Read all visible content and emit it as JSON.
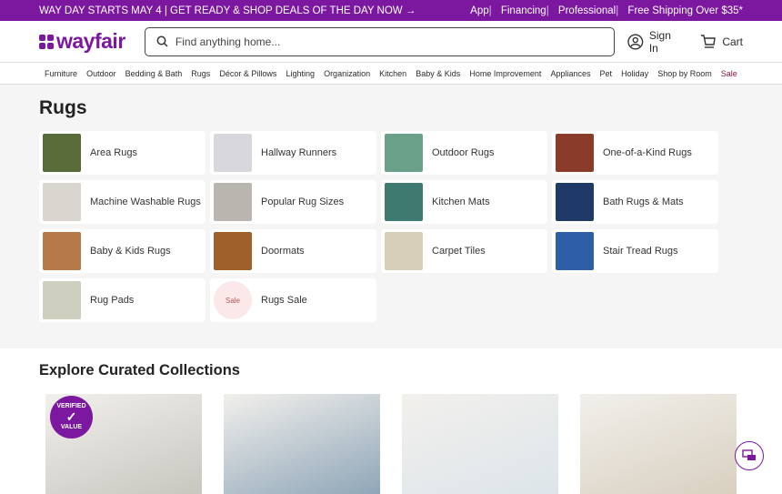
{
  "promo": {
    "left": "WAY DAY STARTS MAY 4 | GET READY & SHOP DEALS OF THE DAY NOW →",
    "links": [
      "App",
      "Financing",
      "Professional",
      "Free Shipping Over $35*"
    ]
  },
  "header": {
    "logo": "wayfair",
    "search_placeholder": "Find anything home...",
    "sign_in": "Sign In",
    "cart": "Cart"
  },
  "nav": [
    "Furniture",
    "Outdoor",
    "Bedding & Bath",
    "Rugs",
    "Décor & Pillows",
    "Lighting",
    "Organization",
    "Kitchen",
    "Baby & Kids",
    "Home Improvement",
    "Appliances",
    "Pet",
    "Holiday",
    "Shop by Room",
    "Sale"
  ],
  "page_title": "Rugs",
  "categories": [
    {
      "label": "Area Rugs",
      "color": "#5a6b3a"
    },
    {
      "label": "Hallway Runners",
      "color": "#d8d8dc"
    },
    {
      "label": "Outdoor Rugs",
      "color": "#6aa08a"
    },
    {
      "label": "One-of-a-Kind Rugs",
      "color": "#8a3b2a"
    },
    {
      "label": "Machine Washable Rugs",
      "color": "#d9d6d0"
    },
    {
      "label": "Popular Rug Sizes",
      "color": "#b8b6ae"
    },
    {
      "label": "Kitchen Mats",
      "color": "#3f7a70"
    },
    {
      "label": "Bath Rugs & Mats",
      "color": "#1f3a66"
    },
    {
      "label": "Baby & Kids Rugs",
      "color": "#b67a4a"
    },
    {
      "label": "Doormats",
      "color": "#a0602c"
    },
    {
      "label": "Carpet Tiles",
      "color": "#d8cfb8"
    },
    {
      "label": "Stair Tread Rugs",
      "color": "#2f5ea8"
    },
    {
      "label": "Rug Pads",
      "color": "#cfcfc0"
    },
    {
      "label": "Rugs Sale",
      "sale_badge": "Sale"
    }
  ],
  "curated": {
    "title": "Explore Curated Collections",
    "badge": [
      "VERIFIED",
      "✓",
      "VALUE"
    ],
    "images": [
      "#c9c6c0",
      "#8fa6b8",
      "#dde5ea",
      "#d8d0c0"
    ]
  },
  "colors": {
    "brand": "#7b189f",
    "sale": "#8a1538"
  }
}
